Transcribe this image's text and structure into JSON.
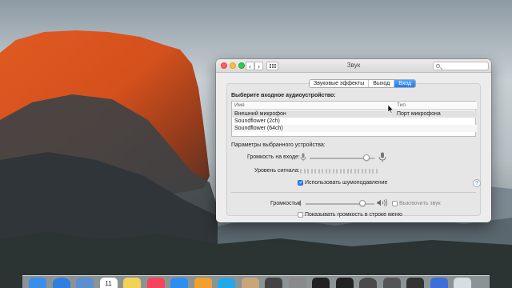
{
  "window": {
    "title": "Звук",
    "search_placeholder": "",
    "nav_back": "‹",
    "nav_forward": "›"
  },
  "tabs": [
    {
      "label": "Звуковые эффекты",
      "active": false
    },
    {
      "label": "Выход",
      "active": false
    },
    {
      "label": "Вход",
      "active": true
    }
  ],
  "input_section": {
    "heading": "Выберите входное аудиоустройство:",
    "columns": [
      "Имя",
      "Тип"
    ],
    "devices": [
      {
        "name": "Внешний микрофон",
        "type": "Порт микрофона",
        "selected": true
      },
      {
        "name": "Soundflower (2ch)",
        "type": ""
      },
      {
        "name": "Soundflower (64ch)",
        "type": ""
      }
    ]
  },
  "device_settings": {
    "heading": "Параметры выбранного устройства:",
    "input_volume_label": "Громкость на входе:",
    "input_volume_level": 0.86,
    "signal_level_label": "Уровень сигнала:",
    "signal_level_active_cells": 0,
    "noise_reduction_label": "Использовать шумоподавление",
    "noise_reduction_checked": true
  },
  "output": {
    "volume_label": "Громкость:",
    "volume_level": 0.82,
    "mute_label": "Выключить звук",
    "mute_checked": false,
    "show_in_menu_label": "Показывать громкость в строке меню",
    "show_in_menu_checked": false
  },
  "help_label": "?",
  "dock": {
    "icons": [
      "finder-icon",
      "safari-icon",
      "mail-icon",
      "calendar-icon",
      "notes-icon",
      "music-icon",
      "app-store-icon",
      "photos-icon",
      "skype-icon",
      "contacts-icon",
      "photos-booth-icon",
      "system-preferences-icon",
      "terminal-icon",
      "ableton-icon",
      "logic-icon",
      "misc-app-icon",
      "keyboard-icon",
      "downloads-icon",
      "trash-icon"
    ],
    "calendar_day": "11"
  }
}
